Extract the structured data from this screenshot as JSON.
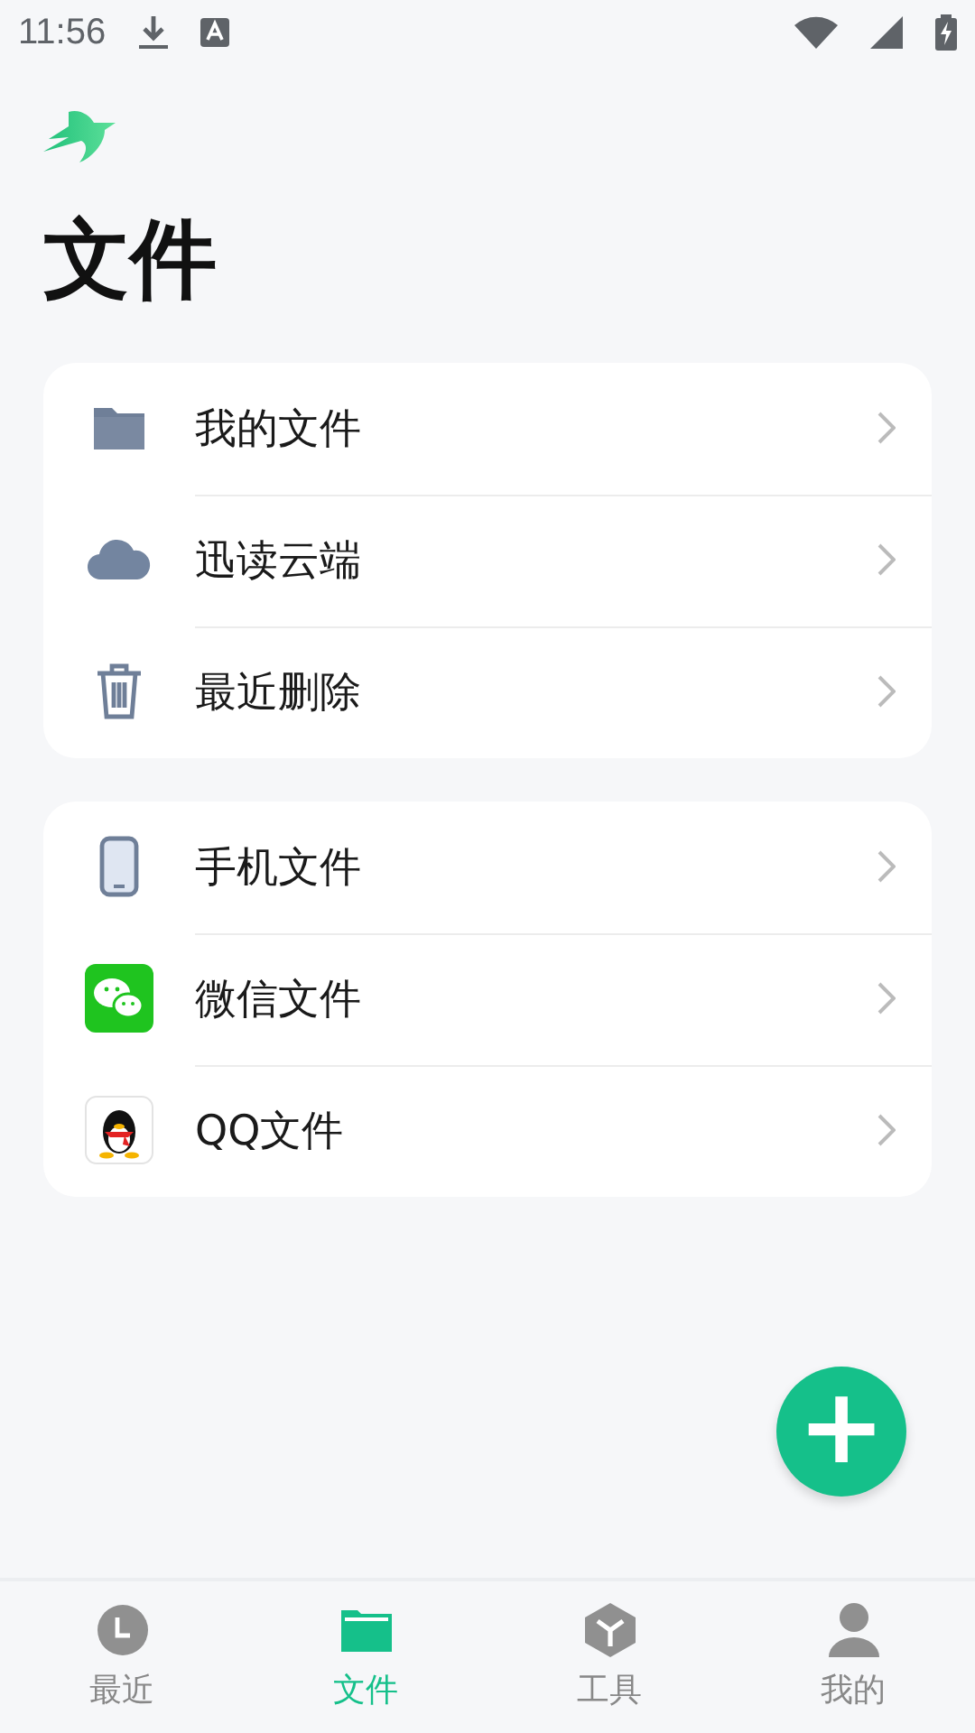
{
  "status_bar": {
    "time": "11:56"
  },
  "title": "文件",
  "groups": [
    {
      "items": [
        {
          "kind": "folder",
          "label": "我的文件"
        },
        {
          "kind": "cloud",
          "label": "迅读云端"
        },
        {
          "kind": "trash",
          "label": "最近删除"
        }
      ]
    },
    {
      "items": [
        {
          "kind": "phone",
          "label": "手机文件"
        },
        {
          "kind": "wechat",
          "label": "微信文件"
        },
        {
          "kind": "qq",
          "label": "QQ文件"
        }
      ]
    }
  ],
  "fab": {
    "label": "+"
  },
  "tabs": [
    {
      "kind": "clock",
      "label": "最近",
      "selected": false
    },
    {
      "kind": "folder",
      "label": "文件",
      "selected": true
    },
    {
      "kind": "cube",
      "label": "工具",
      "selected": false
    },
    {
      "kind": "person",
      "label": "我的",
      "selected": false
    }
  ]
}
